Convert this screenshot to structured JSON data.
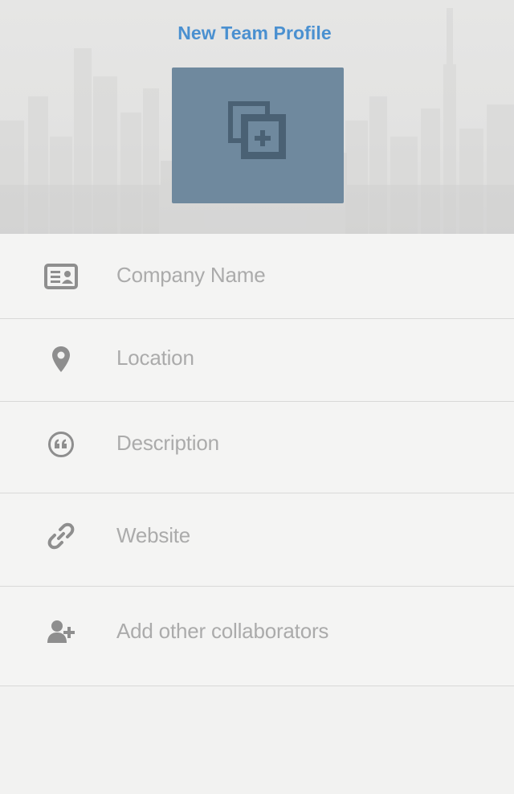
{
  "header": {
    "title": "New Team Profile",
    "add_photo_icon": "add-photo-icon"
  },
  "form": {
    "fields": [
      {
        "icon": "id-card-icon",
        "placeholder": "Company Name"
      },
      {
        "icon": "map-pin-icon",
        "placeholder": "Location"
      },
      {
        "icon": "quote-icon",
        "placeholder": "Description"
      },
      {
        "icon": "link-icon",
        "placeholder": "Website"
      },
      {
        "icon": "add-user-icon",
        "placeholder": "Add other collaborators"
      }
    ]
  },
  "colors": {
    "title": "#4a90d0",
    "photo_button": "#6f899e",
    "icon": "#8e8e8e",
    "placeholder_text": "#ababab",
    "divider": "#d9d9d8"
  }
}
